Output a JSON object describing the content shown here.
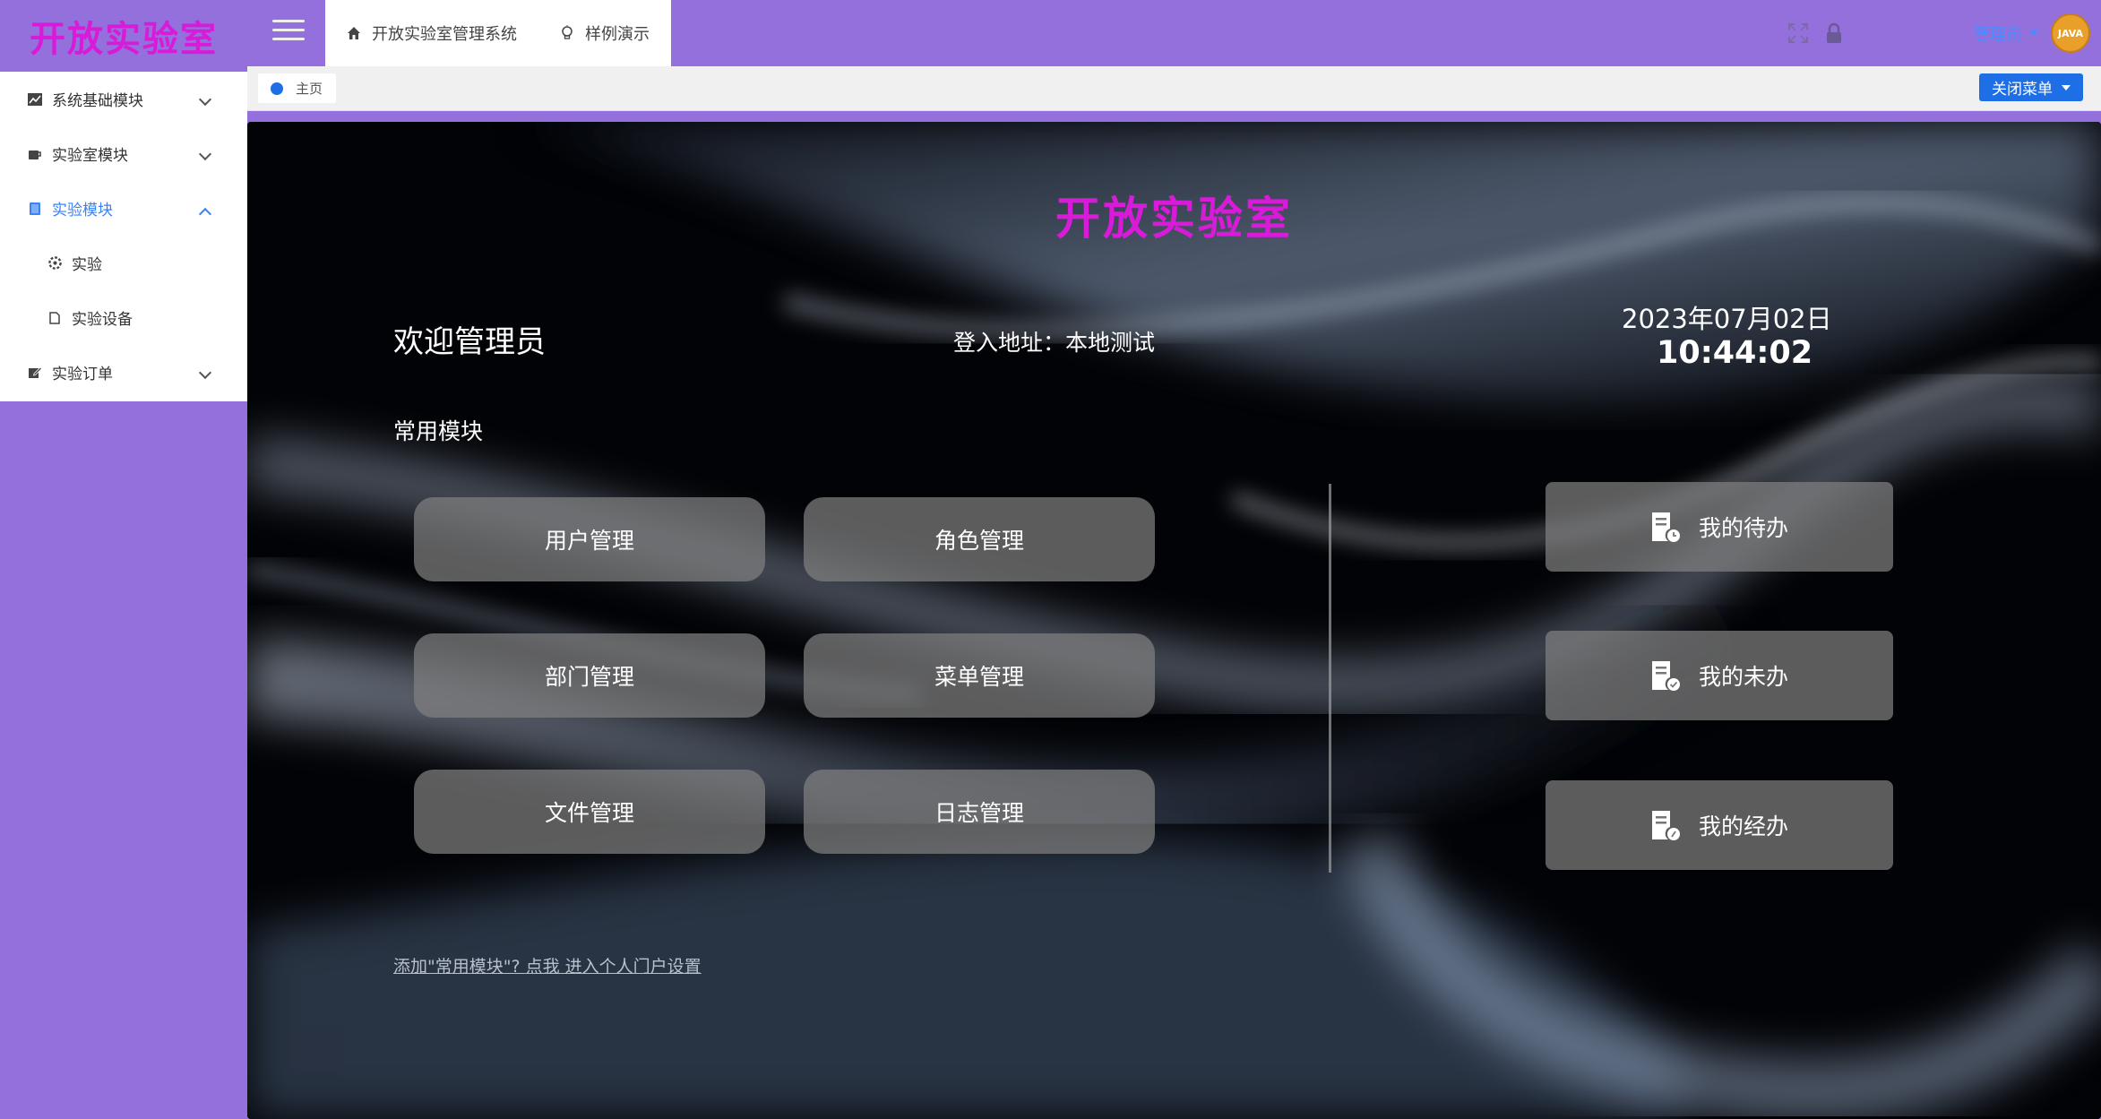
{
  "logo": {
    "text": "开放实验室"
  },
  "header": {
    "tabs": [
      {
        "label": "开放实验室管理系统",
        "icon": "home-icon"
      },
      {
        "label": "样例演示",
        "icon": "lightbulb-icon"
      }
    ],
    "right": {
      "fullscreen_icon": "fullscreen-icon",
      "lock_icon": "lock-icon",
      "username": "管理员",
      "avatar_text": "JAVA"
    }
  },
  "sidebar": {
    "items": [
      {
        "label": "系统基础模块",
        "icon": "chart-icon",
        "expanded": false
      },
      {
        "label": "实验室模块",
        "icon": "coffee-icon",
        "expanded": false
      },
      {
        "label": "实验模块",
        "icon": "document-icon",
        "expanded": true,
        "active": true
      },
      {
        "label": "实验",
        "icon": "gear-icon",
        "sub": true
      },
      {
        "label": "实验设备",
        "icon": "file-icon",
        "sub": true
      },
      {
        "label": "实验订单",
        "icon": "edit-icon",
        "expanded": false
      }
    ]
  },
  "tabsbar": {
    "home_tab": "主页",
    "close_menu": "关闭菜单"
  },
  "main": {
    "site_title": "开放实验室",
    "welcome": "欢迎管理员",
    "login_address": "登入地址：本地测试",
    "date": "2023年07月02日",
    "time": "10:44:02",
    "common_title": "常用模块",
    "modules": [
      "用户管理",
      "角色管理",
      "部门管理",
      "菜单管理",
      "文件管理",
      "日志管理"
    ],
    "tasks": [
      {
        "label": "我的待办",
        "icon": "todo-icon"
      },
      {
        "label": "我的未办",
        "icon": "pending-icon"
      },
      {
        "label": "我的经办",
        "icon": "handled-icon"
      }
    ],
    "hint": "添加\"常用模块\"? 点我 进入个人门户设置"
  },
  "colors": {
    "sidebar_bg": "#9370db",
    "title_magenta": "#d81bd8",
    "accent_blue": "#1e6fe6",
    "active_blue": "#3b82f6"
  }
}
